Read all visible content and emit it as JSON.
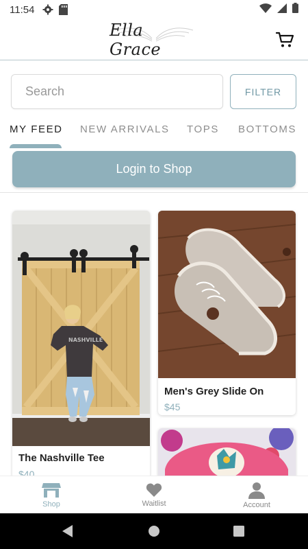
{
  "status_bar": {
    "time": "11:54",
    "icons_left": [
      "settings-icon",
      "sd-card-icon"
    ],
    "icons_right": [
      "wifi-icon",
      "signal-icon",
      "battery-icon"
    ]
  },
  "header": {
    "logo_text": "Ella Grace",
    "cart_icon": "cart-icon"
  },
  "search": {
    "placeholder": "Search",
    "filter_label": "FILTER"
  },
  "tabs": [
    {
      "label": "MY FEED",
      "active": true
    },
    {
      "label": "NEW ARRIVALS",
      "active": false
    },
    {
      "label": "TOPS",
      "active": false
    },
    {
      "label": "BOTTOMS",
      "active": false
    }
  ],
  "login_label": "Login to Shop",
  "products": [
    {
      "name": "The Nashville Tee",
      "price": "$40"
    },
    {
      "name": "Men's Grey Slide On",
      "price": "$45"
    },
    {
      "name": "",
      "price": ""
    }
  ],
  "bottom_nav": [
    {
      "label": "Shop",
      "icon": "store-icon",
      "active": true
    },
    {
      "label": "Waitlist",
      "icon": "heart-icon",
      "active": false
    },
    {
      "label": "Account",
      "icon": "account-icon",
      "active": false
    }
  ],
  "colors": {
    "accent": "#8fb0bb",
    "text": "#222222",
    "muted": "#8e8e8e"
  }
}
